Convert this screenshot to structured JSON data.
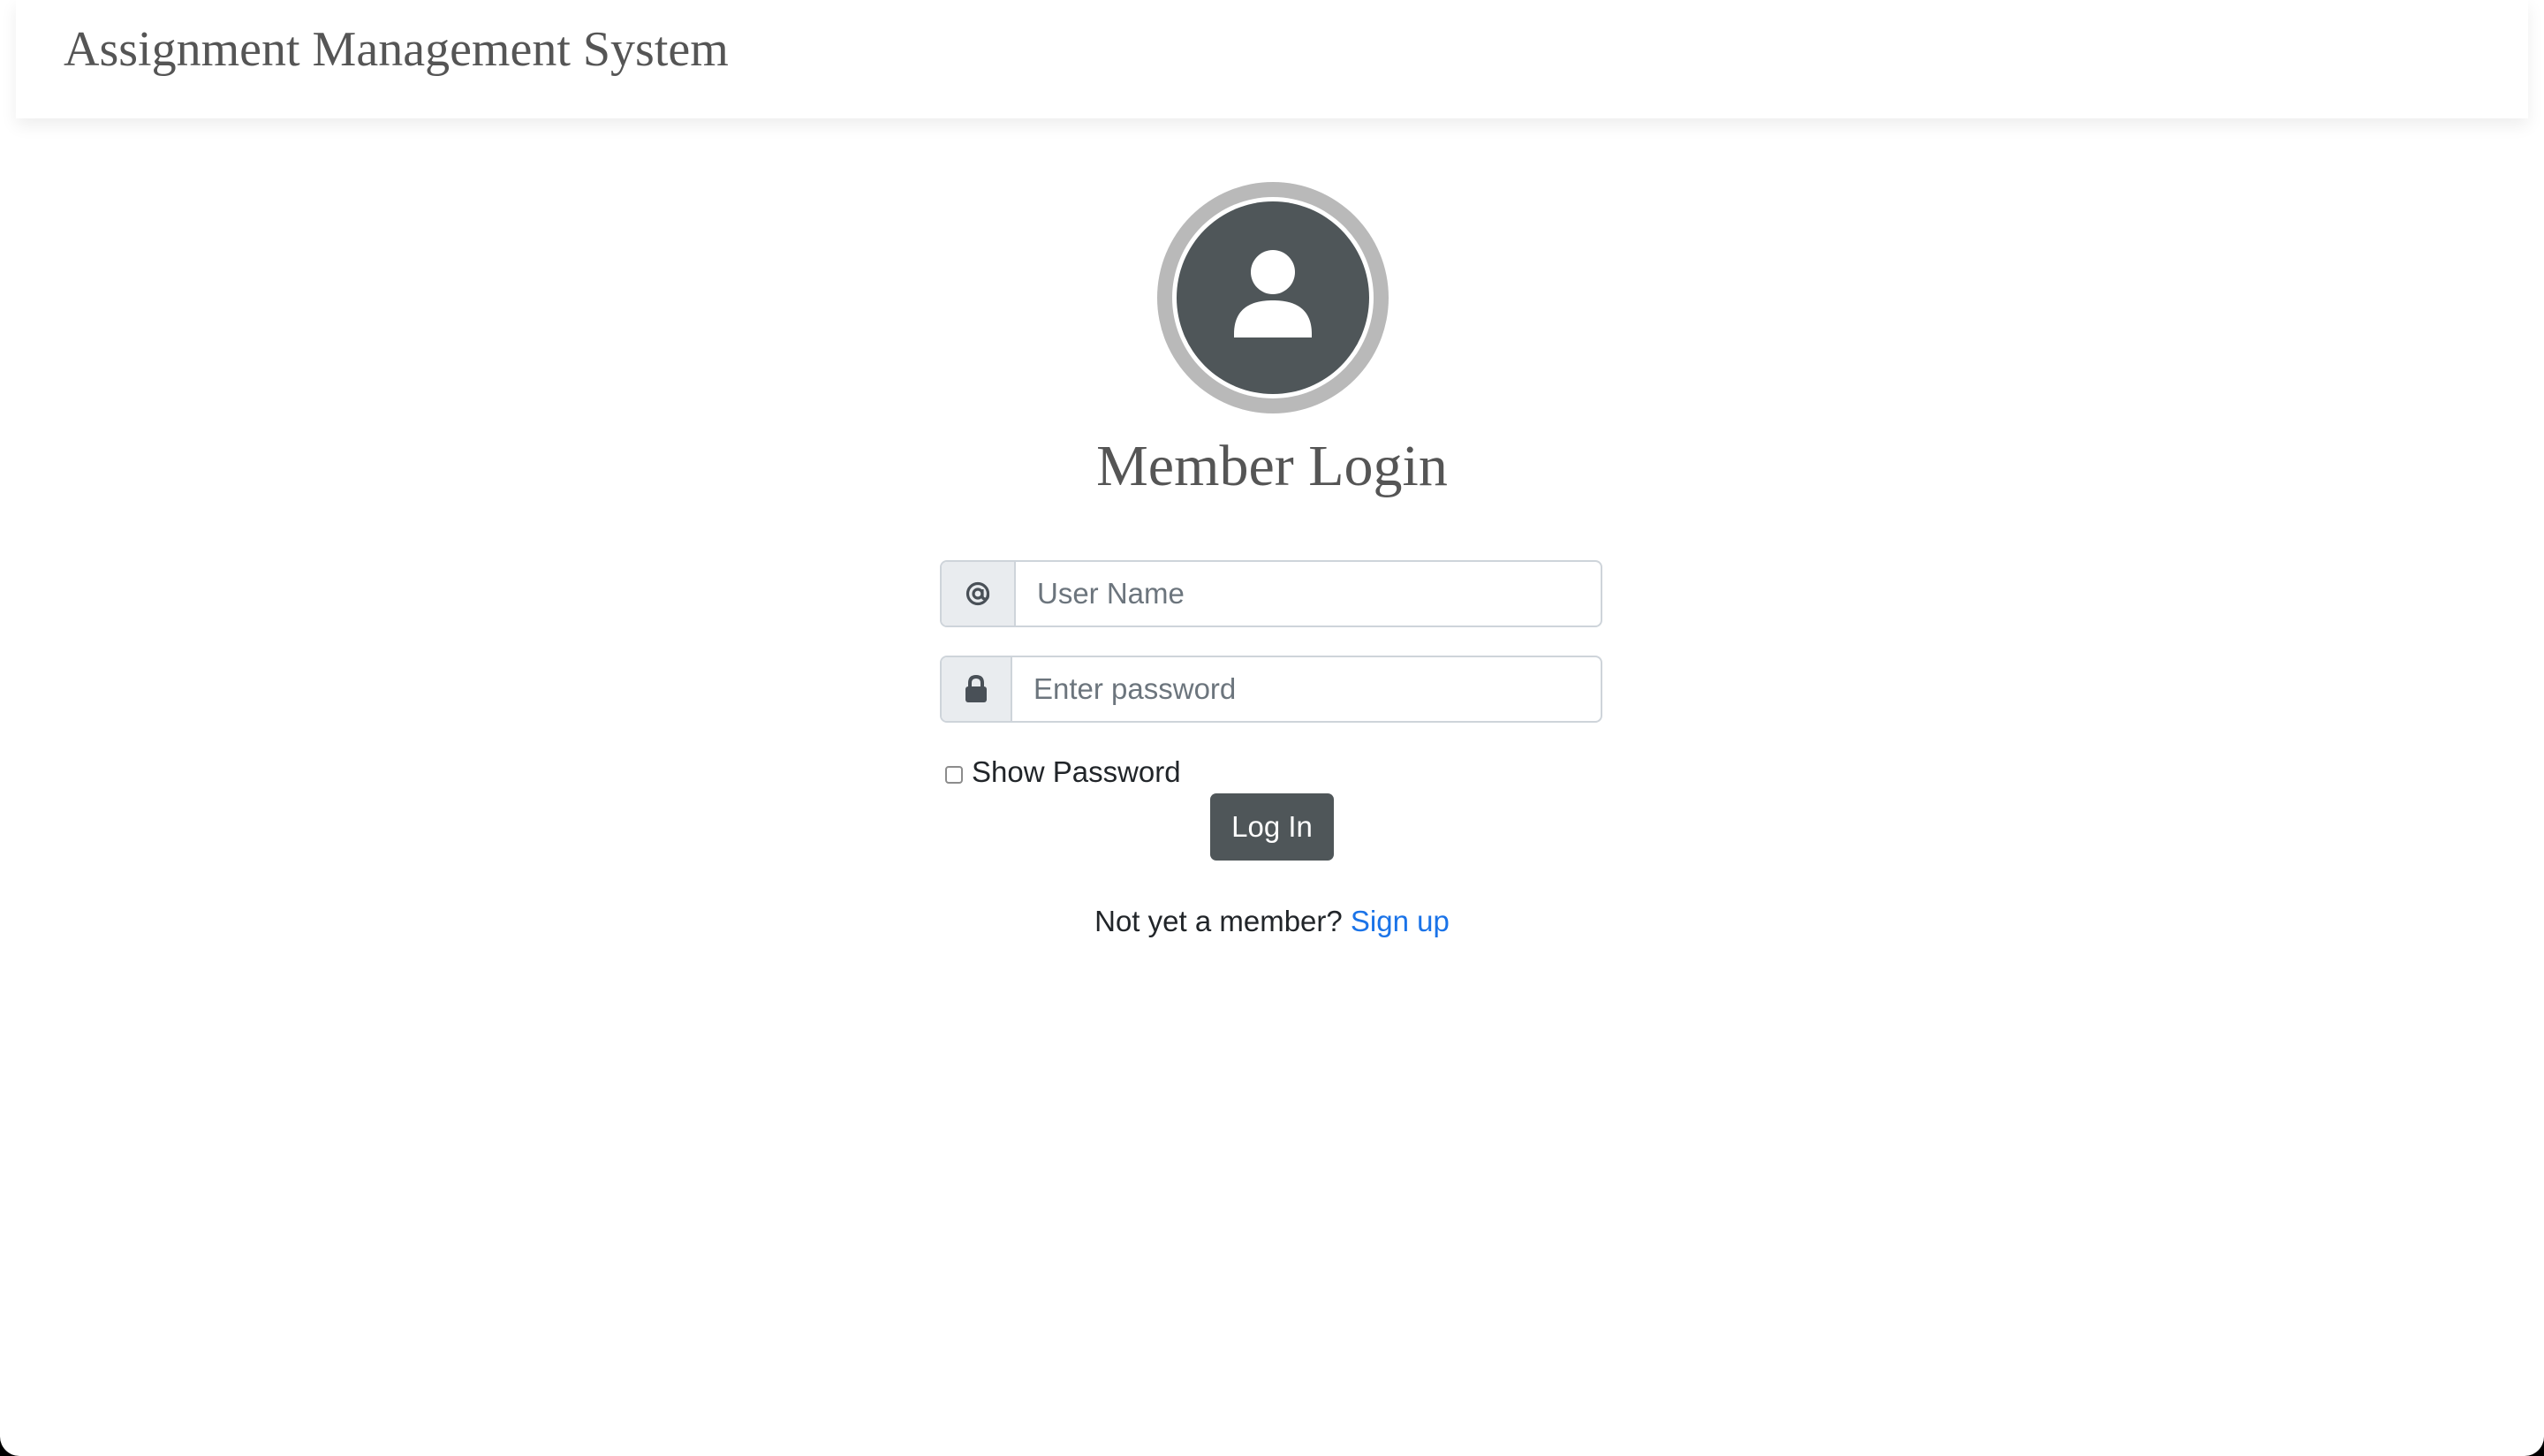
{
  "header": {
    "brand": "Assignment Management System"
  },
  "login": {
    "title": "Member Login",
    "username": {
      "icon": "at-icon",
      "placeholder": "User Name",
      "value": ""
    },
    "password": {
      "icon": "lock-icon",
      "placeholder": "Enter password",
      "value": ""
    },
    "show_password": {
      "label": "Show Password",
      "checked": false
    },
    "submit_label": "Log In",
    "signup_prompt": "Not yet a member?",
    "signup_link": "Sign up"
  },
  "avatar": {
    "icon": "user-icon"
  },
  "colors": {
    "button_bg": "#4f5659",
    "link": "#1a73e8",
    "heading": "#555555",
    "addon_bg": "#e9ecef",
    "border": "#ced4da"
  }
}
